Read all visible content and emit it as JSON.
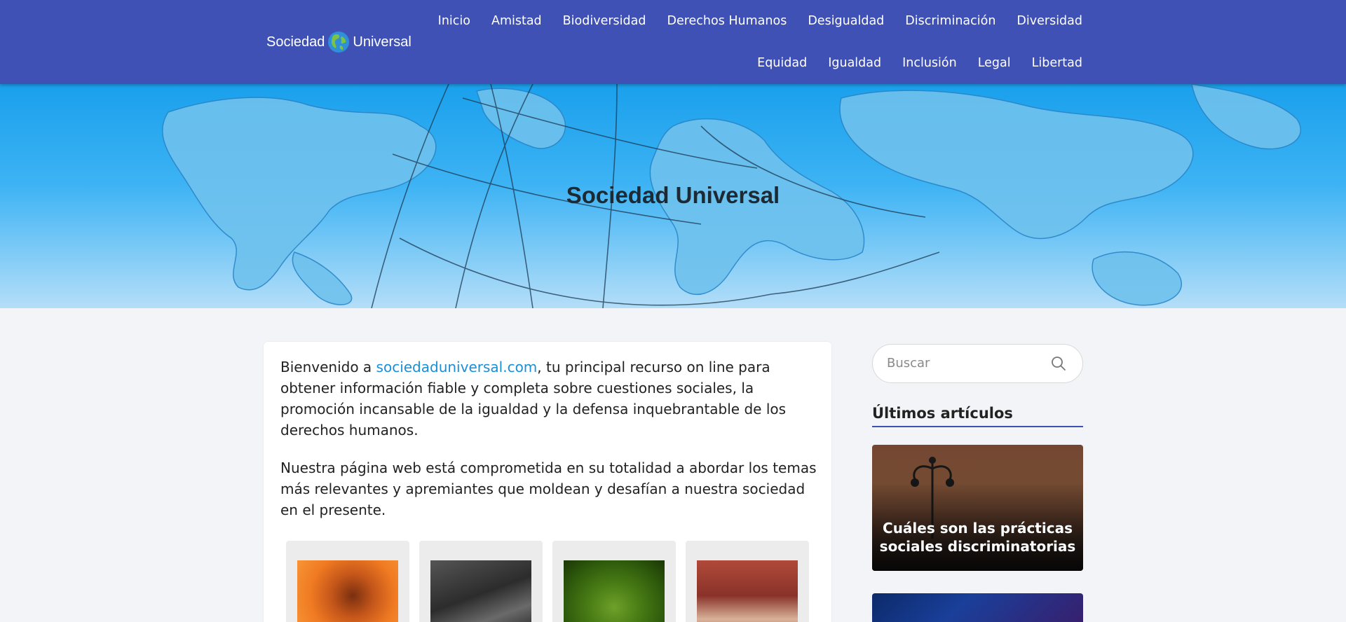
{
  "brand": {
    "name_left": "Sociedad",
    "name_right": "Universal",
    "logo_icon": "globe-icon"
  },
  "nav": {
    "row1": [
      "Inicio",
      "Amistad",
      "Biodiversidad",
      "Derechos Humanos",
      "Desigualdad",
      "Discriminación",
      "Diversidad"
    ],
    "row2": [
      "Equidad",
      "Igualdad",
      "Inclusión",
      "Legal",
      "Libertad"
    ]
  },
  "hero": {
    "title": "Sociedad Universal"
  },
  "article": {
    "p1_before": "Bienvenido a ",
    "p1_link": "sociedaduniversal.com",
    "p1_after": ", tu principal recurso on line para obtener información fiable y completa sobre cuestiones sociales, la promoción incansable de la igualdad y la defensa inquebrantable de los derechos humanos.",
    "p2": "Nuestra página web está comprometida en su totalidad a abordar los temas más relevantes y apremiantes que moldean y desafían a nuestra sociedad en el presente."
  },
  "sidebar": {
    "search_placeholder": "Buscar",
    "heading": "Últimos artículos",
    "posts": [
      {
        "title": "Cuáles son las prácticas sociales discriminatorias"
      },
      {
        "title": ""
      }
    ]
  },
  "colors": {
    "header": "#3f51b5",
    "link": "#1a8fd8",
    "hero_top": "#1aa0ec"
  }
}
